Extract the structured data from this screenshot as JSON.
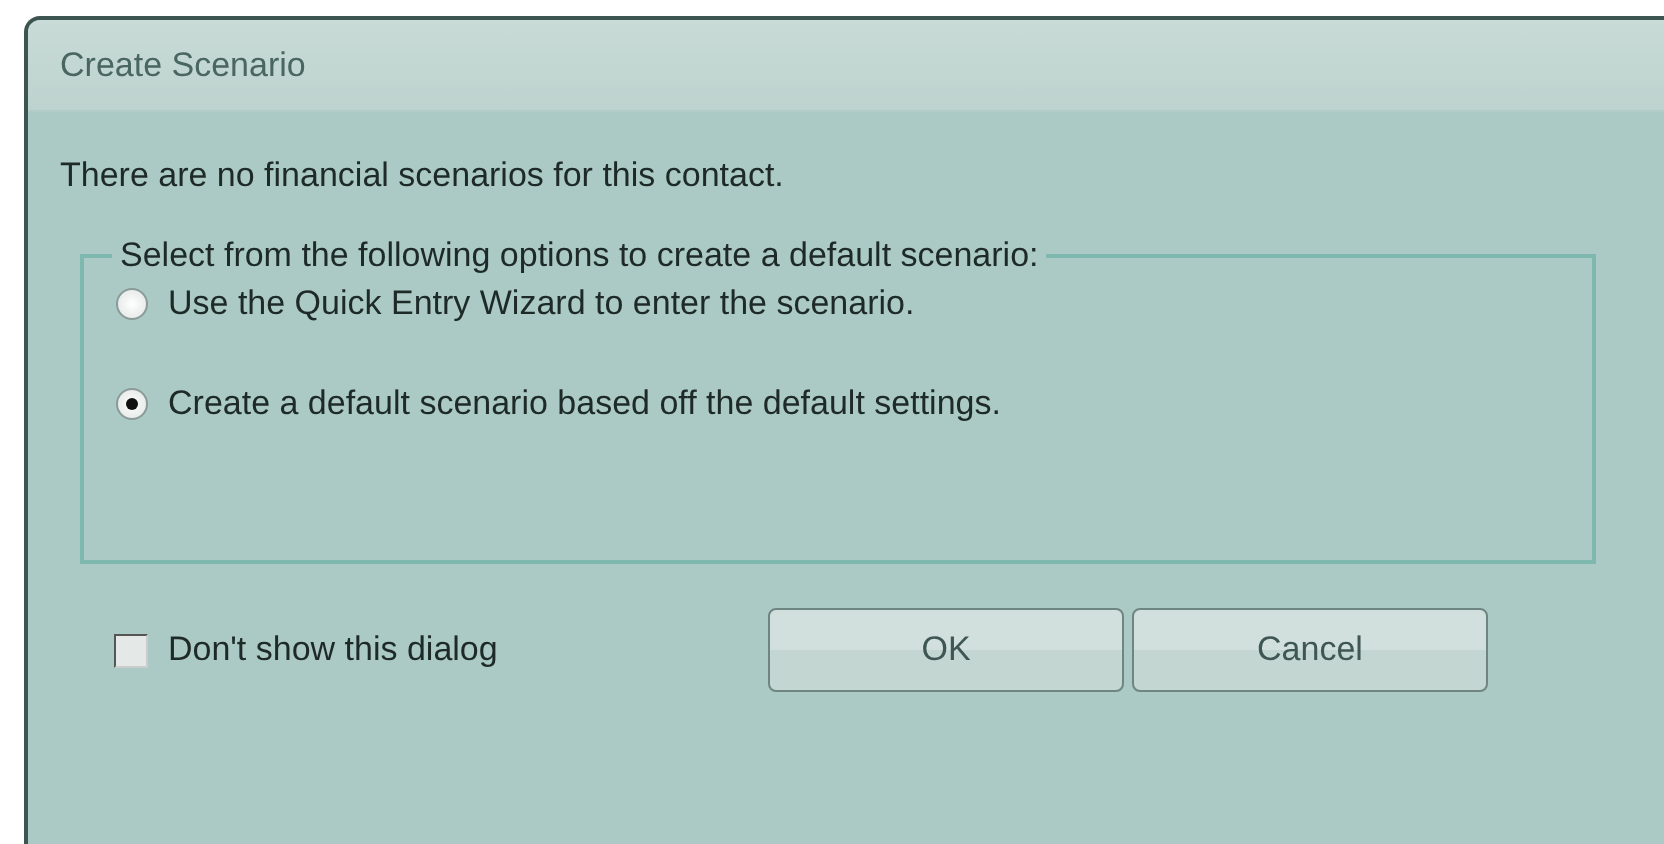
{
  "window": {
    "title": "Create Scenario"
  },
  "message": "There are no financial scenarios for this contact.",
  "group": {
    "legend": "Select from the following options to create a default scenario:",
    "options": [
      {
        "label": "Use the Quick Entry Wizard to enter the scenario.",
        "selected": false
      },
      {
        "label": "Create a default scenario based off the default settings.",
        "selected": true
      }
    ]
  },
  "dont_show": {
    "label": "Don't show this dialog",
    "checked": false
  },
  "buttons": [
    "OK",
    "Cancel"
  ]
}
